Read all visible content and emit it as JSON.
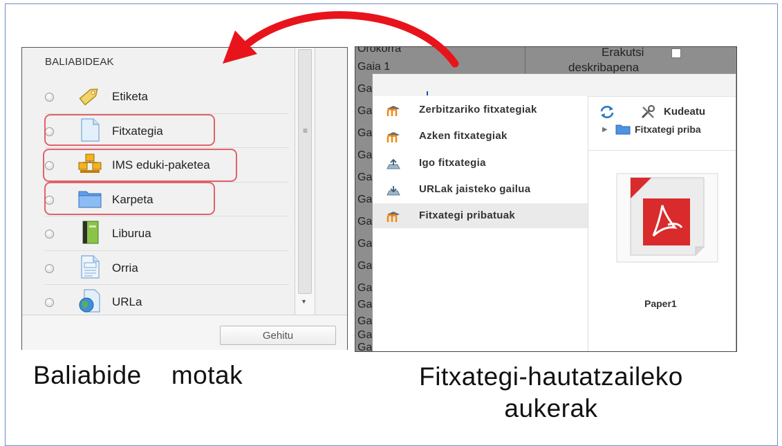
{
  "left_panel": {
    "title": "BALIABIDEAK",
    "items": [
      {
        "label": "Etiketa",
        "icon": "tag-icon"
      },
      {
        "label": "Fitxategia",
        "icon": "file-icon"
      },
      {
        "label": "IMS eduki-paketea",
        "icon": "package-icon"
      },
      {
        "label": "Karpeta",
        "icon": "folder-icon"
      },
      {
        "label": "Liburua",
        "icon": "book-icon"
      },
      {
        "label": "Orria",
        "icon": "page-icon"
      },
      {
        "label": "URLa",
        "icon": "url-globe-icon"
      }
    ],
    "add_button": "Gehitu"
  },
  "right_panel": {
    "background": {
      "rows": [
        "Orokorra",
        "Gaia 1",
        "Ga",
        "Ga",
        "Ga",
        "Ga",
        "Ga",
        "Ga",
        "Ga",
        "Ga",
        "Ga",
        "Ga",
        "Ga",
        "Ga",
        "Ga",
        "Ga"
      ],
      "show_description_line1": "Erakutsi",
      "show_description_line2": "deskribapena"
    },
    "nav": [
      {
        "label": "Zerbitzariko fitxategiak",
        "icon": "moodle-icon"
      },
      {
        "label": "Azken fitxategiak",
        "icon": "moodle-icon"
      },
      {
        "label": "Igo fitxategia",
        "icon": "upload-icon"
      },
      {
        "label": "URLak jaisteko gailua",
        "icon": "url-download-icon"
      },
      {
        "label": "Fitxategi pribatuak",
        "icon": "moodle-icon",
        "active": true
      }
    ],
    "toolbar": {
      "manage_label": "Kudeatu"
    },
    "breadcrumb": "Fitxategi priba",
    "file": {
      "name": "Paper1",
      "icon": "pdf-icon"
    }
  },
  "captions": {
    "left": "Baliabide    motak",
    "right_line1": "Fitxategi-hautatzaileko",
    "right_line2": "aukerak"
  },
  "colors": {
    "arrow": "#e8141c",
    "highlight": "#e0626a",
    "pdf": "#d92b2b"
  }
}
